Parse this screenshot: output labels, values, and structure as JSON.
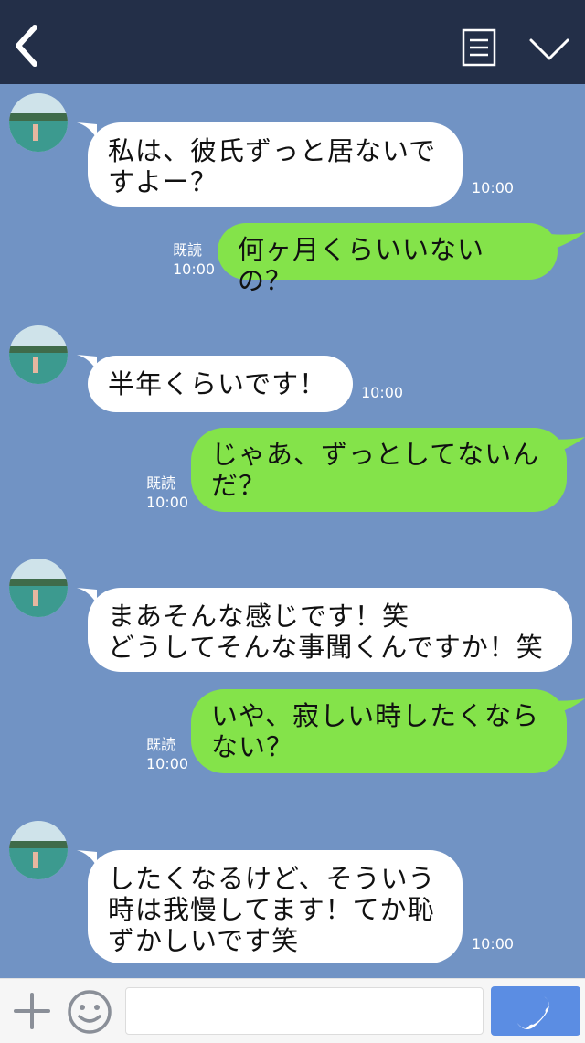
{
  "header": {
    "back_icon": "chevron-left-icon",
    "menu_icon": "menu-list-icon",
    "expand_icon": "chevron-down-icon",
    "background": "#232f48"
  },
  "chat": {
    "background": "#7193c4",
    "messages": [
      {
        "side": "incoming",
        "text": "私は、彼氏ずっと居ないで\nすよー？",
        "time": "10:00"
      },
      {
        "side": "outgoing",
        "text": "何ヶ月くらいいないの？",
        "read": "既読",
        "time": "10:00"
      },
      {
        "side": "incoming",
        "text": "半年くらいです！",
        "time": "10:00"
      },
      {
        "side": "outgoing",
        "text": "じゃあ、ずっとしてないん\nだ？",
        "read": "既読",
        "time": "10:00"
      },
      {
        "side": "incoming",
        "text": "まあそんな感じです！笑\nどうしてそんな事聞くんですか！笑",
        "time": ""
      },
      {
        "side": "outgoing",
        "text": "いや、寂しい時したくなら\nない？",
        "read": "既読",
        "time": "10:00"
      },
      {
        "side": "incoming",
        "text": "したくなるけど、そういう\n時は我慢してます！てか恥\nずかしいです笑",
        "time": "10:00"
      }
    ]
  },
  "footer": {
    "plus_icon": "plus-icon",
    "emoji_icon": "smiley-icon",
    "input_value": "",
    "call_icon": "phone-icon",
    "call_color": "#5b8de3"
  },
  "colors": {
    "incoming_bubble": "#ffffff",
    "outgoing_bubble": "#84e34a"
  }
}
